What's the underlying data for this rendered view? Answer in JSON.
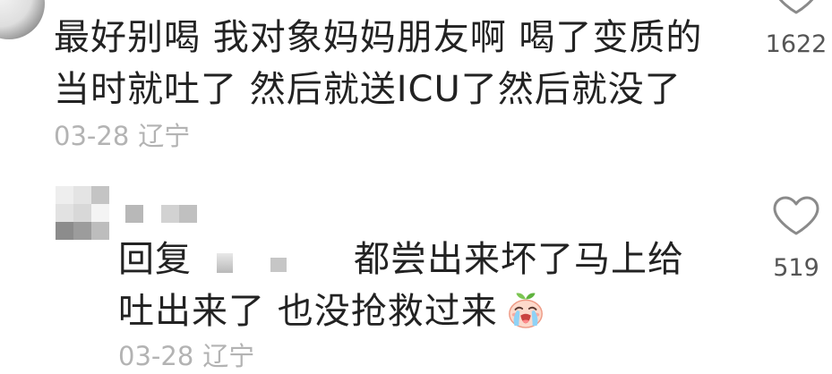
{
  "comment": {
    "lines": [
      "最好别喝 我对象妈妈朋友啊 喝了变质的",
      "当时就吐了 然后就送ICU了然后就没了"
    ],
    "date": "03-28",
    "location": "辽宁",
    "likes": "1622",
    "like_icon": "heart-outline-icon"
  },
  "reply": {
    "prefix": "回复",
    "lines": [
      "都尝出来坏了马上给",
      "吐出来了 也没抢救过来"
    ],
    "emoji": "crying-face-emoji",
    "date": "03-28",
    "location": "辽宁",
    "likes": "519",
    "like_icon": "heart-outline-icon"
  },
  "colors": {
    "background": "#ffffff",
    "text": "#222222",
    "meta": "#b3b3b3",
    "count": "#555555",
    "icon": "#8a8a8a"
  }
}
